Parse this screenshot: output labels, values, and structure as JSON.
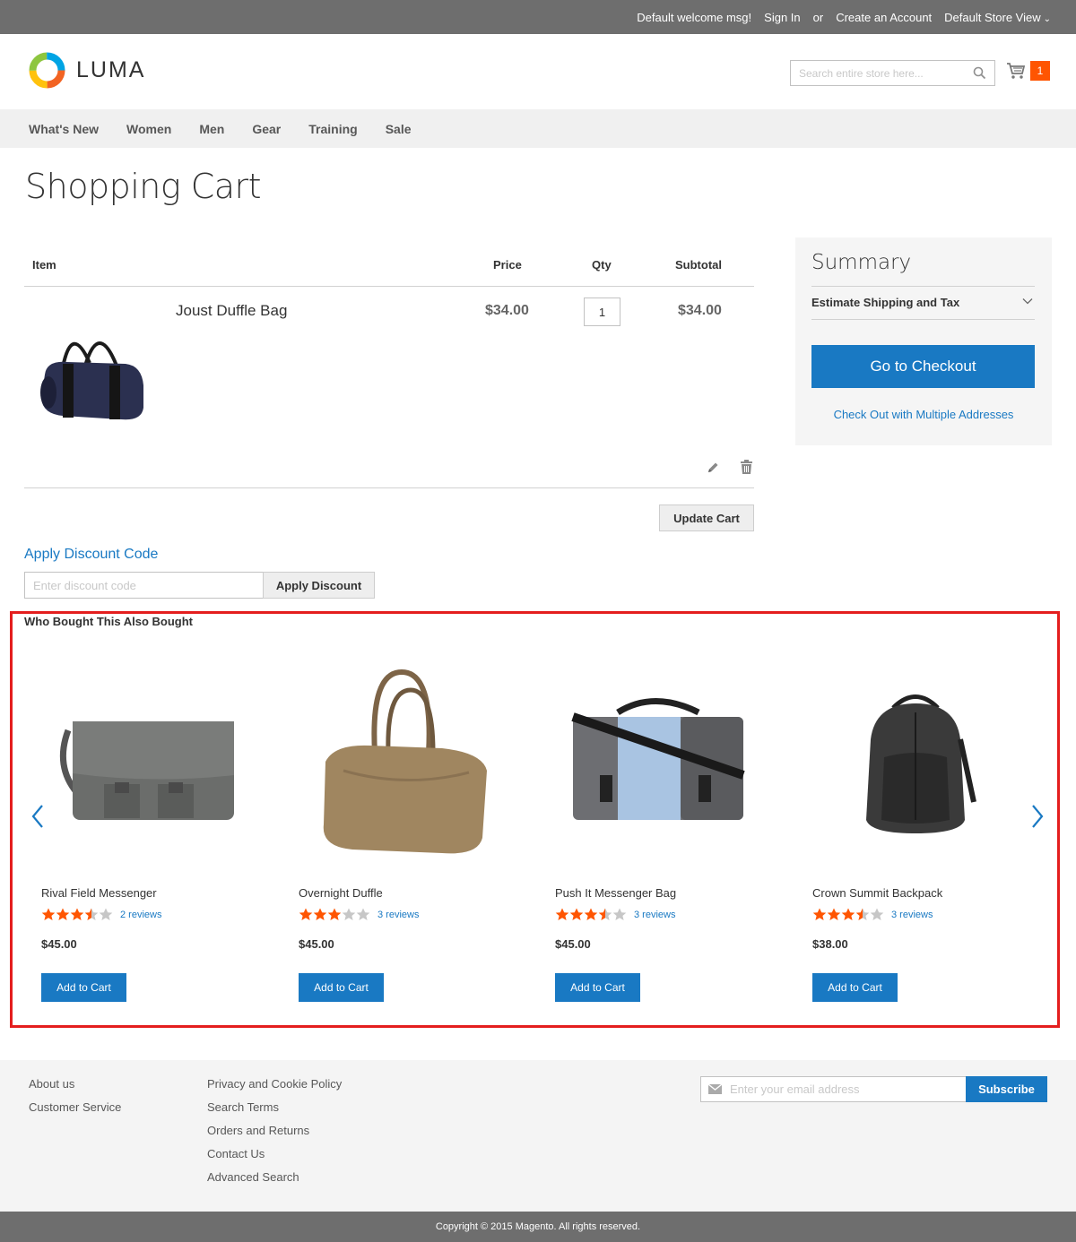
{
  "topbar": {
    "welcome": "Default welcome msg!",
    "sign_in": "Sign In",
    "or": "or",
    "create_account": "Create an Account",
    "store_view": "Default Store View"
  },
  "header": {
    "logo_text": "LUMA",
    "search_placeholder": "Search entire store here...",
    "cart_count": "1"
  },
  "nav": [
    "What's New",
    "Women",
    "Men",
    "Gear",
    "Training",
    "Sale"
  ],
  "page_title": "Shopping Cart",
  "cart": {
    "columns": {
      "item": "Item",
      "price": "Price",
      "qty": "Qty",
      "subtotal": "Subtotal"
    },
    "items": [
      {
        "name": "Joust Duffle Bag",
        "price": "$34.00",
        "qty": "1",
        "subtotal": "$34.00"
      }
    ],
    "update_label": "Update Cart"
  },
  "discount": {
    "title": "Apply Discount Code",
    "placeholder": "Enter discount code",
    "button": "Apply Discount"
  },
  "summary": {
    "title": "Summary",
    "shipping_label": "Estimate Shipping and Tax",
    "checkout_label": "Go to Checkout",
    "multi_label": "Check Out with Multiple Addresses"
  },
  "related": {
    "title": "Who Bought This Also Bought",
    "add_label": "Add to Cart",
    "products": [
      {
        "name": "Rival Field Messenger",
        "rating": 3.5,
        "reviews": "2 reviews",
        "price": "$45.00"
      },
      {
        "name": "Overnight Duffle",
        "rating": 3,
        "reviews": "3 reviews",
        "price": "$45.00"
      },
      {
        "name": "Push It Messenger Bag",
        "rating": 3.5,
        "reviews": "3 reviews",
        "price": "$45.00"
      },
      {
        "name": "Crown Summit Backpack",
        "rating": 3.5,
        "reviews": "3 reviews",
        "price": "$38.00"
      }
    ]
  },
  "footer": {
    "col1": [
      "About us",
      "Customer Service"
    ],
    "col2": [
      "Privacy and Cookie Policy",
      "Search Terms",
      "Orders and Returns",
      "Contact Us",
      "Advanced Search"
    ],
    "newsletter_placeholder": "Enter your email address",
    "subscribe_label": "Subscribe",
    "copyright": "Copyright © 2015 Magento. All rights reserved."
  },
  "colors": {
    "primary": "#1979c3",
    "accent": "#ff5501",
    "highlight_border": "#e41e1e",
    "star": "#ff5501"
  }
}
